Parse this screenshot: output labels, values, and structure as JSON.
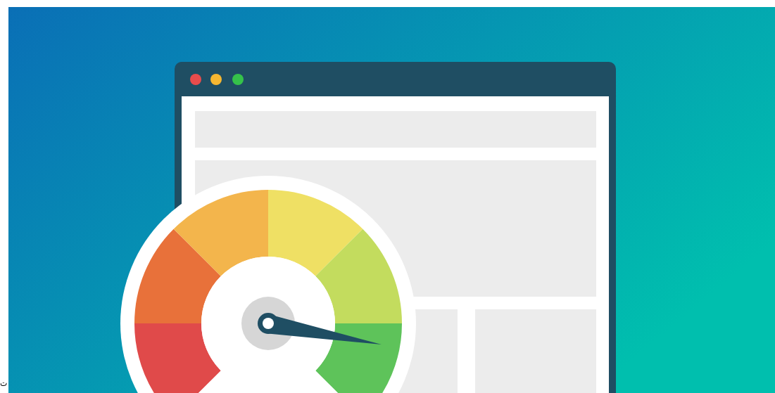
{
  "page_text": {
    "fragment": "ت"
  }
}
